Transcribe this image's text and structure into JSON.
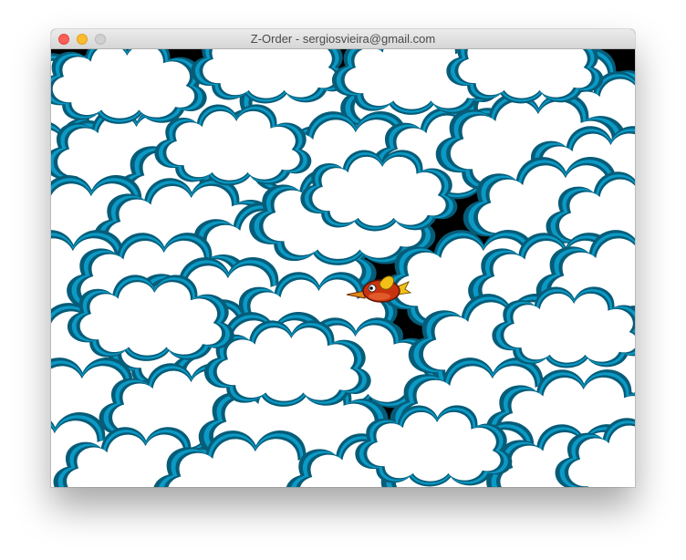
{
  "window": {
    "title": "Z-Order - sergiosvieira@gmail.com",
    "traffic_lights": [
      "close",
      "minimize",
      "maximize"
    ]
  },
  "scene": {
    "background": "#000000",
    "cloud_fill": "#ffffff",
    "cloud_outline": "#0a9ac6",
    "cloud_outline_dark": "#075c78",
    "player": {
      "sprite": "red-bird",
      "body_color": "#c8330f",
      "wing_color": "#f2c018",
      "beak_color": "#e38a1a"
    }
  }
}
